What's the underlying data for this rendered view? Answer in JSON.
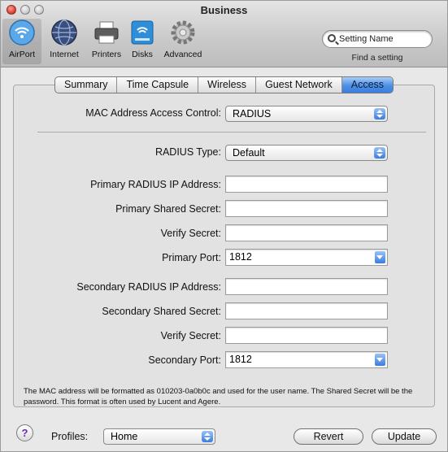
{
  "window": {
    "title": "Business"
  },
  "toolbar": {
    "items": [
      {
        "label": "AirPort",
        "icon": "airport-icon"
      },
      {
        "label": "Internet",
        "icon": "internet-icon"
      },
      {
        "label": "Printers",
        "icon": "printer-icon"
      },
      {
        "label": "Disks",
        "icon": "disk-icon"
      },
      {
        "label": "Advanced",
        "icon": "gear-icon"
      }
    ],
    "search_placeholder": "Setting Name",
    "search_caption": "Find a setting"
  },
  "tabs": [
    "Summary",
    "Time Capsule",
    "Wireless",
    "Guest Network",
    "Access"
  ],
  "active_tab": "Access",
  "form": {
    "mac_access_label": "MAC Address Access Control:",
    "mac_access_value": "RADIUS",
    "radius_type_label": "RADIUS Type:",
    "radius_type_value": "Default",
    "primary_ip_label": "Primary RADIUS IP Address:",
    "primary_ip_value": "",
    "primary_secret_label": "Primary Shared Secret:",
    "primary_secret_value": "",
    "primary_verify_label": "Verify Secret:",
    "primary_verify_value": "",
    "primary_port_label": "Primary Port:",
    "primary_port_value": "1812",
    "secondary_ip_label": "Secondary RADIUS IP Address:",
    "secondary_ip_value": "",
    "secondary_secret_label": "Secondary Shared Secret:",
    "secondary_secret_value": "",
    "secondary_verify_label": "Verify Secret:",
    "secondary_verify_value": "",
    "secondary_port_label": "Secondary Port:",
    "secondary_port_value": "1812",
    "note": "The MAC address will be formatted as 010203-0a0b0c and used for the user name. The Shared Secret will be the password. This format is often used by Lucent and Agere."
  },
  "footer": {
    "help_label": "?",
    "profiles_label": "Profiles:",
    "profiles_value": "Home",
    "revert_label": "Revert",
    "update_label": "Update"
  },
  "colors": {
    "accent": "#3a7ddf",
    "close": "#e0443a"
  }
}
